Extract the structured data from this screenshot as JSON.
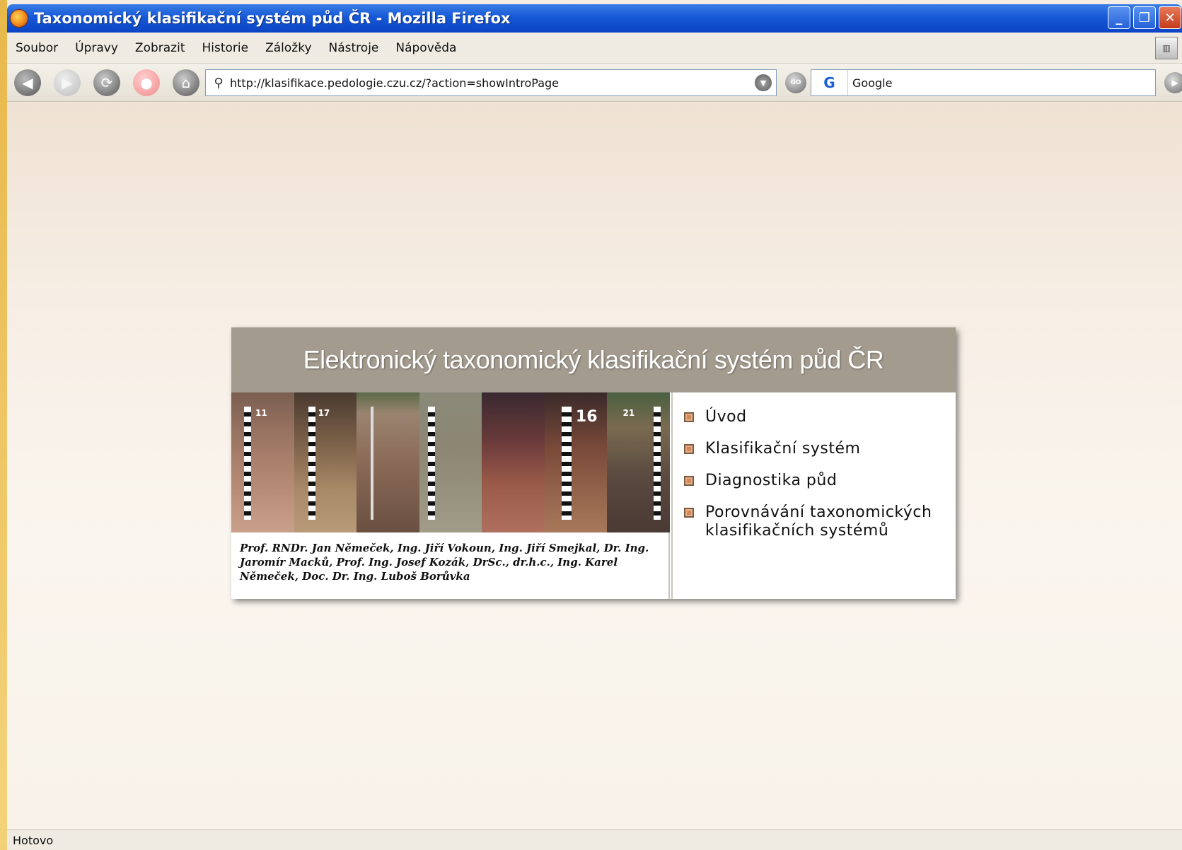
{
  "window": {
    "title": "Taxonomický klasifikační systém půd ČR - Mozilla Firefox"
  },
  "menubar": {
    "items": [
      "Soubor",
      "Úpravy",
      "Zobrazit",
      "Historie",
      "Záložky",
      "Nástroje",
      "Nápověda"
    ]
  },
  "navbar": {
    "url": "http://klasifikace.pedologie.czu.cz/?action=showIntroPage",
    "search_engine_glyph": "G",
    "search_value": "Google"
  },
  "page": {
    "header_title": "Elektronický taxonomický klasifikační systém půd ČR",
    "authors": "Prof. RNDr. Jan Němeček, Ing. Jiří Vokoun, Ing. Jiří Smejkal, Dr. Ing. Jaromír Macků, Prof. Ing. Josef Kozák, DrSc., dr.h.c., Ing. Karel Němeček, Doc. Dr. Ing. Luboš Borůvka",
    "menu": [
      {
        "label": "Úvod"
      },
      {
        "label": "Klasifikační systém"
      },
      {
        "label": "Diagnostika půd"
      },
      {
        "label": "Porovnávání taxonomických klasifikačních systémů"
      }
    ],
    "soil_profile_labels": [
      "11",
      "17",
      "16",
      "21"
    ]
  },
  "statusbar": {
    "text": "Hotovo"
  },
  "colors": {
    "titlebar": "#1658d6",
    "header_bg": "#a49b8f",
    "content_bg": "#f7efe6",
    "bullet": "#d08a5a"
  }
}
